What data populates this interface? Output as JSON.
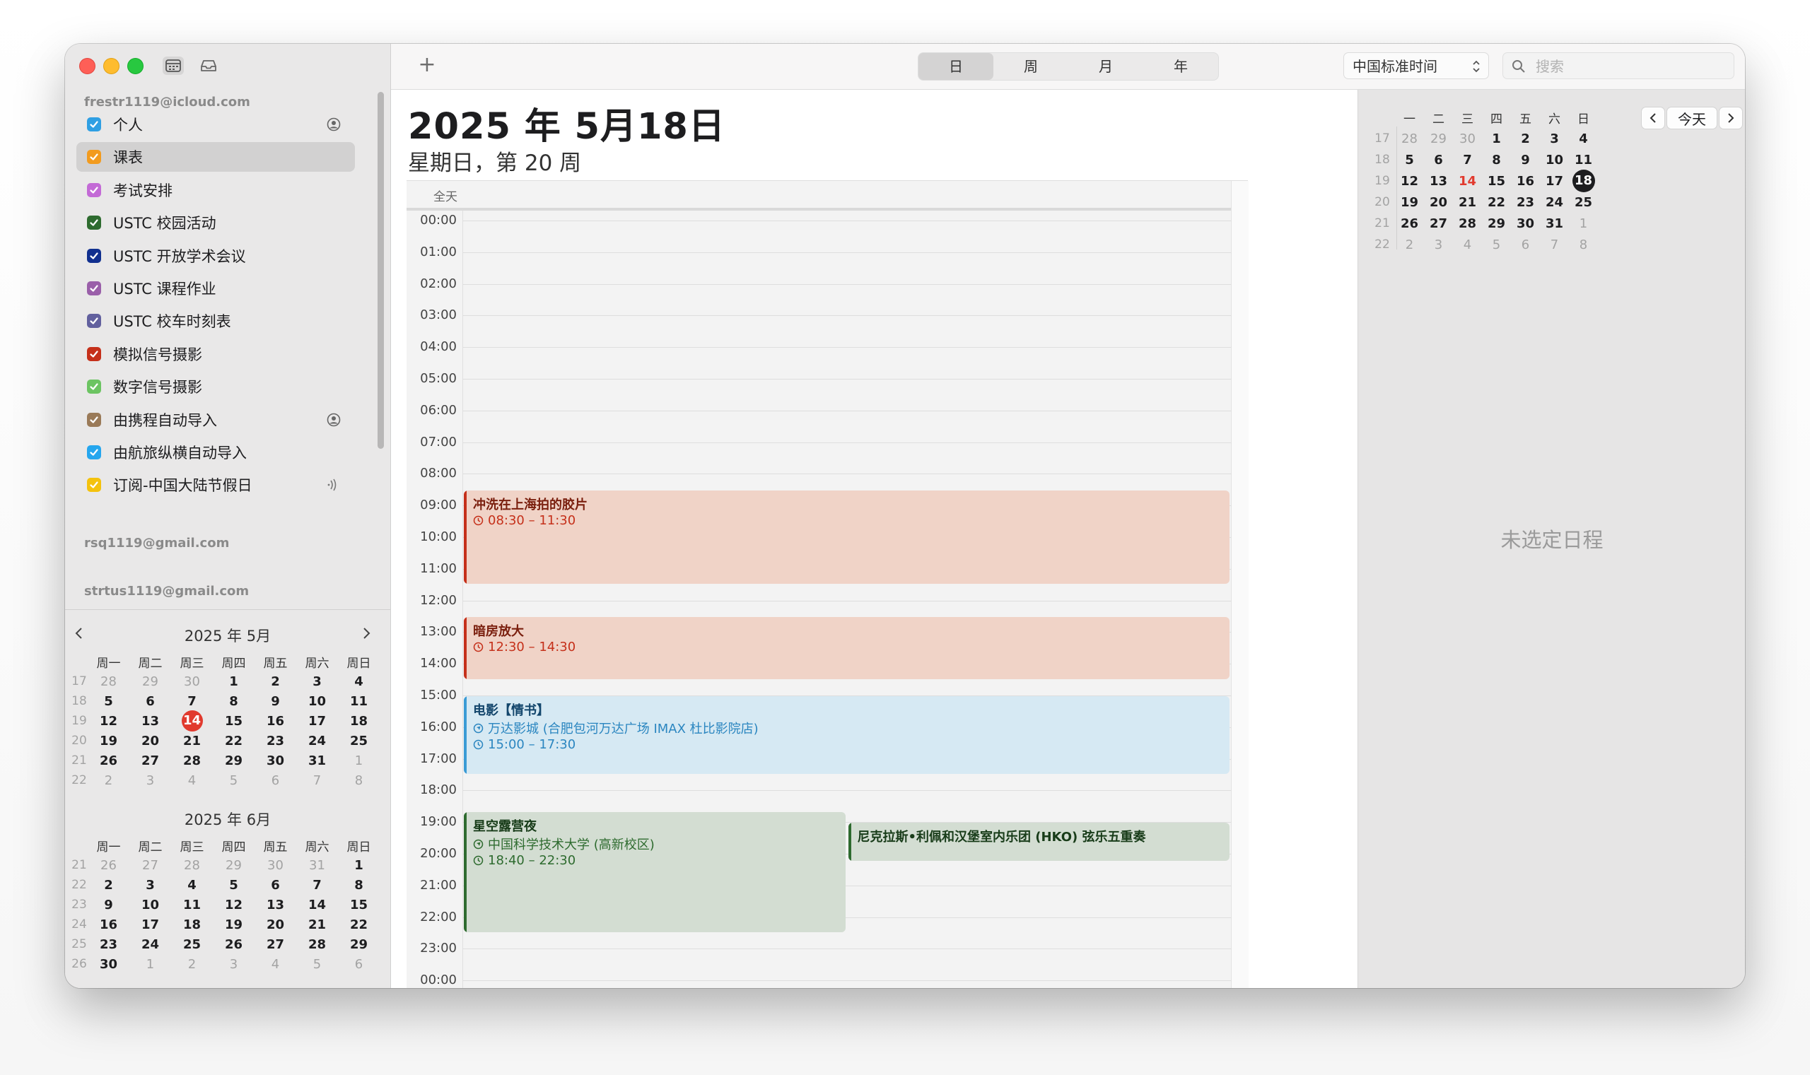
{
  "sidebar": {
    "accounts": [
      "frestr1119@icloud.com",
      "rsq1119@gmail.com",
      "strtus1119@gmail.com"
    ],
    "calendars": [
      {
        "label": "个人",
        "color": "#2f9fe3",
        "icon": "person-circle-icon"
      },
      {
        "label": "课表",
        "color": "#f29b1f",
        "selected": true
      },
      {
        "label": "考试安排",
        "color": "#c36ad6"
      },
      {
        "label": "USTC 校园活动",
        "color": "#2e6b2f"
      },
      {
        "label": "USTC 开放学术会议",
        "color": "#11308f"
      },
      {
        "label": "USTC 课程作业",
        "color": "#9a5fa9"
      },
      {
        "label": "USTC 校车时刻表",
        "color": "#62609e"
      },
      {
        "label": "模拟信号摄影",
        "color": "#c5301a"
      },
      {
        "label": "数字信号摄影",
        "color": "#6cc462"
      },
      {
        "label": "由携程自动导入",
        "color": "#9a7a58",
        "icon": "person-circle-icon"
      },
      {
        "label": "由航旅纵横自动导入",
        "color": "#25a6ee"
      },
      {
        "label": "订阅-中国大陆节假日",
        "color": "#f4c20d",
        "icon": "broadcast-icon"
      }
    ],
    "mini_may": {
      "title": "2025 年 5月",
      "headers": [
        "周一",
        "周二",
        "周三",
        "周四",
        "周五",
        "周六",
        "周日"
      ],
      "weeks": [
        {
          "wk": "17",
          "days": [
            "28",
            "29",
            "30",
            "1",
            "2",
            "3",
            "4"
          ]
        },
        {
          "wk": "18",
          "days": [
            "5",
            "6",
            "7",
            "8",
            "9",
            "10",
            "11"
          ]
        },
        {
          "wk": "19",
          "days": [
            "12",
            "13",
            "14",
            "15",
            "16",
            "17",
            "18"
          ]
        },
        {
          "wk": "20",
          "days": [
            "19",
            "20",
            "21",
            "22",
            "23",
            "24",
            "25"
          ]
        },
        {
          "wk": "21",
          "days": [
            "26",
            "27",
            "28",
            "29",
            "30",
            "31",
            "1"
          ]
        },
        {
          "wk": "22",
          "days": [
            "2",
            "3",
            "4",
            "5",
            "6",
            "7",
            "8"
          ]
        }
      ],
      "today": "14"
    },
    "mini_june": {
      "title": "2025 年 6月",
      "headers": [
        "周一",
        "周二",
        "周三",
        "周四",
        "周五",
        "周六",
        "周日"
      ],
      "weeks": [
        {
          "wk": "21",
          "days": [
            "26",
            "27",
            "28",
            "29",
            "30",
            "31",
            "1"
          ]
        },
        {
          "wk": "22",
          "days": [
            "2",
            "3",
            "4",
            "5",
            "6",
            "7",
            "8"
          ]
        },
        {
          "wk": "23",
          "days": [
            "9",
            "10",
            "11",
            "12",
            "13",
            "14",
            "15"
          ]
        },
        {
          "wk": "24",
          "days": [
            "16",
            "17",
            "18",
            "19",
            "20",
            "21",
            "22"
          ]
        },
        {
          "wk": "25",
          "days": [
            "23",
            "24",
            "25",
            "26",
            "27",
            "28",
            "29"
          ]
        },
        {
          "wk": "26",
          "days": [
            "30",
            "1",
            "2",
            "3",
            "4",
            "5",
            "6"
          ]
        }
      ]
    }
  },
  "toolbar": {
    "add_label": "+",
    "views": [
      "日",
      "周",
      "月",
      "年"
    ],
    "active_view": "日",
    "timezone": "中国标准时间",
    "search_placeholder": "搜索"
  },
  "main": {
    "date_title": "2025 年 5月18日",
    "date_subtitle": "星期日，第 20 周",
    "allday_label": "全天",
    "hours": [
      "00:00",
      "01:00",
      "02:00",
      "03:00",
      "04:00",
      "05:00",
      "06:00",
      "07:00",
      "08:00",
      "09:00",
      "10:00",
      "11:00",
      "12:00",
      "13:00",
      "14:00",
      "15:00",
      "16:00",
      "17:00",
      "18:00",
      "19:00",
      "20:00",
      "21:00",
      "22:00",
      "23:00",
      "00:00"
    ],
    "events": [
      {
        "title": "冲洗在上海拍的胶片",
        "time": "08:30 – 11:30",
        "start": 8.5,
        "end": 11.5,
        "column": 0,
        "columns": 1,
        "calendar": "模拟信号摄影",
        "bg": "#f0d3c7",
        "bar": "#c5301a",
        "text": "#7a1f0e",
        "sub": "#c5301a"
      },
      {
        "title": "暗房放大",
        "time": "12:30 – 14:30",
        "start": 12.5,
        "end": 14.5,
        "column": 0,
        "columns": 1,
        "calendar": "模拟信号摄影",
        "bg": "#f0d3c7",
        "bar": "#c5301a",
        "text": "#7a1f0e",
        "sub": "#c5301a"
      },
      {
        "title": "电影【情书】",
        "location": "万达影城 (合肥包河万达广场 IMAX 杜比影院店)",
        "time": "15:00 – 17:30",
        "start": 15.0,
        "end": 17.5,
        "column": 0,
        "columns": 1,
        "calendar": "由携程自动导入",
        "bg": "#d6e9f3",
        "bar": "#3a9bd5",
        "text": "#13466c",
        "sub": "#2b86c0"
      },
      {
        "title": "星空露营夜",
        "location": "中国科学技术大学 (高新校区)",
        "time": "18:40 – 22:30",
        "start": 18.6667,
        "end": 22.5,
        "column": 0,
        "columns": 2,
        "calendar": "USTC 校园活动",
        "bg": "#d3ddd2",
        "bar": "#2e6b2f",
        "text": "#183c19",
        "sub": "#2e6b2f"
      },
      {
        "title": "尼克拉斯•利佩和汉堡室内乐团 (HKO) 弦乐五重奏",
        "start": 19.0,
        "end": 20.25,
        "column": 1,
        "columns": 2,
        "calendar": "USTC 校园活动",
        "bg": "#d3ddd2",
        "bar": "#2e6b2f",
        "text": "#183c19",
        "sub": "#2e6b2f"
      }
    ]
  },
  "rpanel": {
    "headers": [
      "一",
      "二",
      "三",
      "四",
      "五",
      "六",
      "日"
    ],
    "weeks": [
      {
        "wk": "17",
        "days": [
          "28",
          "29",
          "30",
          "1",
          "2",
          "3",
          "4"
        ]
      },
      {
        "wk": "18",
        "days": [
          "5",
          "6",
          "7",
          "8",
          "9",
          "10",
          "11"
        ]
      },
      {
        "wk": "19",
        "days": [
          "12",
          "13",
          "14",
          "15",
          "16",
          "17",
          "18"
        ]
      },
      {
        "wk": "20",
        "days": [
          "19",
          "20",
          "21",
          "22",
          "23",
          "24",
          "25"
        ]
      },
      {
        "wk": "21",
        "days": [
          "26",
          "27",
          "28",
          "29",
          "30",
          "31",
          "1"
        ]
      },
      {
        "wk": "22",
        "days": [
          "2",
          "3",
          "4",
          "5",
          "6",
          "7",
          "8"
        ]
      }
    ],
    "today": "14",
    "selected": "18",
    "today_label": "今天",
    "empty_label": "未选定日程"
  }
}
